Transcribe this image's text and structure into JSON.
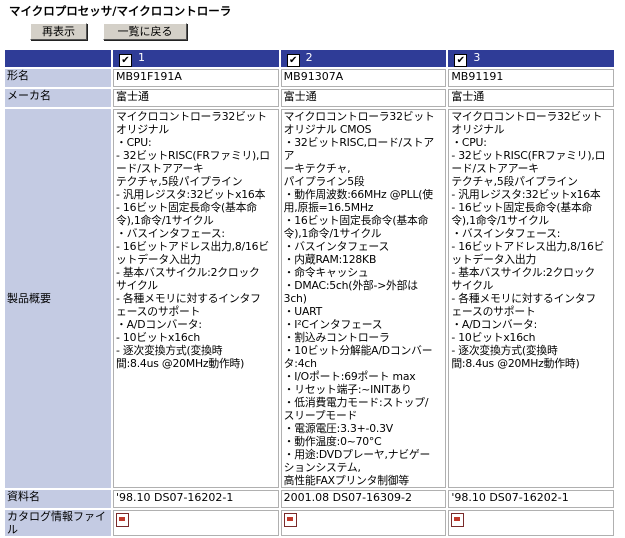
{
  "page": {
    "title": "マイクロプロセッサ/マイクロコントローラ"
  },
  "toolbar": {
    "refresh_label": "再表示",
    "back_label": "一覧に戻る"
  },
  "columns": [
    {
      "index": "1",
      "checked": true
    },
    {
      "index": "2",
      "checked": true
    },
    {
      "index": "3",
      "checked": true
    }
  ],
  "rows": {
    "model": {
      "label": "形名",
      "values": [
        "MB91F191A",
        "MB91307A",
        "MB91191"
      ]
    },
    "maker": {
      "label": "メーカ名",
      "values": [
        "富士通",
        "富士通",
        "富士通"
      ]
    },
    "overview": {
      "label": "製品概要",
      "values": [
        "マイクロコントローラ32ビット\nオリジナル\n・CPU:\n- 32ビットRISC(FRファミリ),ロ\nード/ストアアーキ\nテクチャ,5段パイプライン\n- 汎用レジスタ:32ビットx16本\n- 16ビット固定長命令(基本命\n令),1命令/1サイクル\n・バスインタフェース:\n- 16ビットアドレス出力,8/16ビ\nットデータ入出力\n- 基本バスサイクル:2クロック\nサイクル\n- 各種メモリに対するインタフ\nェースのサポート\n・A/Dコンバータ:\n- 10ビットx16ch\n- 逐次変換方式(変換時\n間:8.4us @20MHz動作時)",
        "マイクロコントローラ32ビット\nオリジナル CMOS\n・32ビットRISC,ロード/ストアア\nーキテクチャ,\nパイプライン5段\n・動作周波数:66MHz @PLL(使\n用,原振=16.5MHz\n・16ビット固定長命令(基本命\n令),1命令/1サイクル\n・バスインタフェース\n・内蔵RAM:128KB\n・命令キャッシュ\n・DMAC:5ch(外部->外部は\n3ch)\n・UART\n・I²Cインタフェース\n・割込みコントローラ\n・10ビット分解能A/Dコンバー\nタ:4ch\n・I/Oポート:69ポート max\n・リセット端子:~INITあり\n・低消費電力モード:ストップ/\nスリープモード\n・電源電圧:3.3+-0.3V\n・動作温度:0~70°C\n・用途:DVDプレーヤ,ナビゲー\nションシステム,\n高性能FAXプリンタ制御等",
        "マイクロコントローラ32ビット\nオリジナル\n・CPU:\n- 32ビットRISC(FRファミリ),ロ\nード/ストアアーキ\nテクチャ,5段パイプライン\n- 汎用レジスタ:32ビットx16本\n- 16ビット固定長命令(基本命\n令),1命令/1サイクル\n・バスインタフェース:\n- 16ビットアドレス出力,8/16ビ\nットデータ入出力\n- 基本バスサイクル:2クロック\nサイクル\n- 各種メモリに対するインタフ\nェースのサポート\n・A/Dコンバータ:\n- 10ビットx16ch\n- 逐次変換方式(変換時\n間:8.4us @20MHz動作時)"
      ]
    },
    "document": {
      "label": "資料名",
      "values": [
        "'98.10 DS07-16202-1",
        "2001.08 DS07-16309-2",
        "'98.10 DS07-16202-1"
      ]
    },
    "catalog": {
      "label": "カタログ情報ファイル",
      "icon": "pdf-file-icon"
    }
  }
}
